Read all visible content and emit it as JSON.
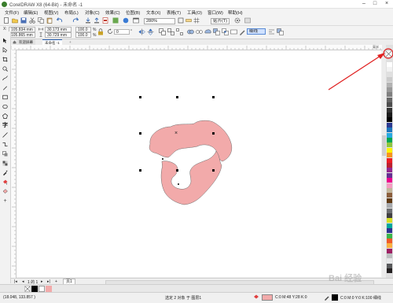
{
  "app": {
    "title": "CorelDRAW X8 (64-Bit) - 未命名 -1"
  },
  "menu": [
    "文件(F)",
    "编辑(E)",
    "视图(V)",
    "布局(L)",
    "对象(C)",
    "效果(C)",
    "位图(B)",
    "文本(X)",
    "表格(T)",
    "工具(O)",
    "窗口(W)",
    "帮助(H)"
  ],
  "toolbar": {
    "zoom": "280%",
    "snap": "贴齐(T)"
  },
  "propbar": {
    "x": "105.834 mm",
    "y": "105.865 mm",
    "w": "30.173 mm",
    "h": "30.729 mm",
    "scale_x": "100.0",
    "scale_y": "100.0",
    "pct": "%",
    "angle": "0",
    "angle_unit": "°",
    "outline": "细线",
    "x_label": "X:",
    "y_label": "Y:"
  },
  "tabs": {
    "welcome": "欢迎屏幕",
    "doc": "未命名 -1"
  },
  "rulers": {
    "unit": "毫米"
  },
  "pagenav": {
    "page_info": "1 的 1",
    "page_tab": "页1"
  },
  "status": {
    "coords": "(18.048, 133.857 )",
    "selection": "选定 2 对象 于 图层1",
    "fill_label": "C:0 M:48 Y:28 K:0",
    "outline_label": "C:0 M:0 Y:0 K:100 细线"
  },
  "watermark": "Bai 经验",
  "colors": {
    "shape_fill": "#f2aaaa",
    "shape_outline": "#6b6b6b",
    "arrow": "#e02020",
    "highlight": "#e02020",
    "palette": [
      "#ffffff",
      "#f2f2f2",
      "#e0e0e0",
      "#cccccc",
      "#b3b3b3",
      "#999999",
      "#808080",
      "#666666",
      "#4d4d4d",
      "#333333",
      "#1a1a1a",
      "#000000",
      "#2b3990",
      "#1c75bc",
      "#27aae1",
      "#00a651",
      "#8dc63f",
      "#fff200",
      "#f7941d",
      "#ed1c24",
      "#be1e2d",
      "#92278f",
      "#662d91",
      "#ec008c",
      "#f49ac1",
      "#c2b59b",
      "#8b5e3c",
      "#603913",
      "#a7a9ac",
      "#6d6e71",
      "#414042",
      "#d7df23",
      "#00a79d",
      "#2e3192",
      "#39b54a",
      "#f15a29",
      "#fbb040",
      "#9e1f63",
      "#bcbec0",
      "#e6e7e8",
      "#58595b",
      "#231f20"
    ]
  }
}
